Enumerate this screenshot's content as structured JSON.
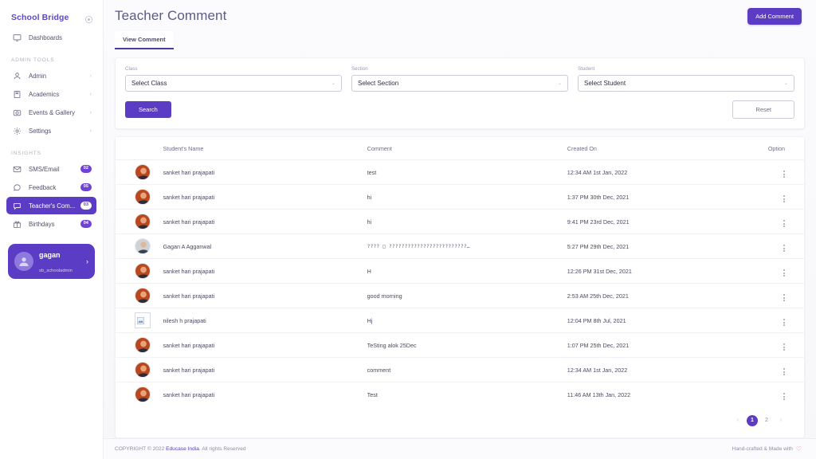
{
  "sidebar": {
    "brand": "School Bridge",
    "brand_icon": "circle-target-icon",
    "dashboards": {
      "label": "Dashboards",
      "icon": "monitor-icon"
    },
    "admin_tools_label": "ADMIN TOOLS",
    "admin_tools": [
      {
        "label": "Admin",
        "icon": "user-icon",
        "chevron": "›"
      },
      {
        "label": "Academics",
        "icon": "book-icon",
        "chevron": "›"
      },
      {
        "label": "Events & Gallery",
        "icon": "camera-icon",
        "chevron": "›"
      },
      {
        "label": "Settings",
        "icon": "gear-icon",
        "chevron": "›"
      }
    ],
    "insights_label": "INSIGHTS",
    "insights": [
      {
        "label": "SMS/Email",
        "icon": "mail-icon",
        "badge": "02",
        "active": false
      },
      {
        "label": "Feedback",
        "icon": "chat-bubble-icon",
        "badge": "05",
        "active": false
      },
      {
        "label": "Teacher's Com...",
        "icon": "comment-icon",
        "badge": "03",
        "active": true
      },
      {
        "label": "Birthdays",
        "icon": "gift-icon",
        "badge": "04",
        "active": false
      }
    ],
    "profile": {
      "name": "gagan",
      "role": "sb_schooladmin",
      "chevron": "›",
      "avatar_icon": "user-avatar-icon"
    }
  },
  "header": {
    "title": "Teacher Comment",
    "add_button": "Add Comment",
    "tabs": [
      {
        "label": "View Comment",
        "active": true
      }
    ]
  },
  "filters": {
    "class": {
      "label": "Class",
      "value": "Select Class",
      "caret": "⌄"
    },
    "section": {
      "label": "Section",
      "value": "Select Section",
      "caret": "⌄"
    },
    "student": {
      "label": "Student",
      "value": "Select Student",
      "caret": "⌄"
    },
    "search_button": "Search",
    "reset_button": "Reset"
  },
  "table": {
    "columns": [
      "Student's Name",
      "Comment",
      "Created On",
      "Option"
    ],
    "rows": [
      {
        "name": "sanket hari prajapati",
        "comment": "test",
        "created_on": "12:34 AM 1st Jan, 2022",
        "avatar": "photo",
        "option_icon": "more-vertical-icon"
      },
      {
        "name": "sanket hari prajapati",
        "comment": "hi",
        "created_on": "1:37 PM 30th Dec, 2021",
        "avatar": "photo",
        "option_icon": "more-vertical-icon"
      },
      {
        "name": "sanket hari prajapati",
        "comment": "hi",
        "created_on": "9:41 PM 23rd Dec, 2021",
        "avatar": "photo",
        "option_icon": "more-vertical-icon"
      },
      {
        "name": "Gagan A Agganwal",
        "comment": "???? □ ?????????????????????????…",
        "created_on": "5:27 PM 29th Dec, 2021",
        "avatar": "photo2",
        "option_icon": "more-vertical-icon"
      },
      {
        "name": "sanket hari prajapati",
        "comment": "H",
        "created_on": "12:26 PM 31st Dec, 2021",
        "avatar": "photo",
        "option_icon": "more-vertical-icon"
      },
      {
        "name": "sanket hari prajapati",
        "comment": "good morning",
        "created_on": "2:53 AM 25th Dec, 2021",
        "avatar": "photo",
        "option_icon": "more-vertical-icon"
      },
      {
        "name": "nilesh h prajapati",
        "comment": "Hj",
        "created_on": "12:04 PM 8th Jul, 2021",
        "avatar": "broken",
        "option_icon": "more-vertical-icon"
      },
      {
        "name": "sanket hari prajapati",
        "comment": "TeSting alok 25Dec",
        "created_on": "1:07 PM 25th Dec, 2021",
        "avatar": "photo",
        "option_icon": "more-vertical-icon"
      },
      {
        "name": "sanket hari prajapati",
        "comment": "comment",
        "created_on": "12:34 AM 1st Jan, 2022",
        "avatar": "photo",
        "option_icon": "more-vertical-icon"
      },
      {
        "name": "sanket hari prajapati",
        "comment": "Test",
        "created_on": "11:46 AM 13th Jan, 2022",
        "avatar": "photo",
        "option_icon": "more-vertical-icon"
      }
    ]
  },
  "pagination": {
    "prev": "‹",
    "pages": [
      "1",
      "2"
    ],
    "active_page": "1",
    "next": "›"
  },
  "footer": {
    "copyright_prefix": "COPYRIGHT © 2022 ",
    "company": "Educase India",
    "copyright_suffix": ". All rights Reserved",
    "right_text": "Hand-crafted & Made with",
    "heart_icon": "heart-icon"
  },
  "colors": {
    "primary": "#5b3cc4",
    "badge": "#6f43d6",
    "title": "#5b5b86",
    "heart": "#e87b9b"
  }
}
